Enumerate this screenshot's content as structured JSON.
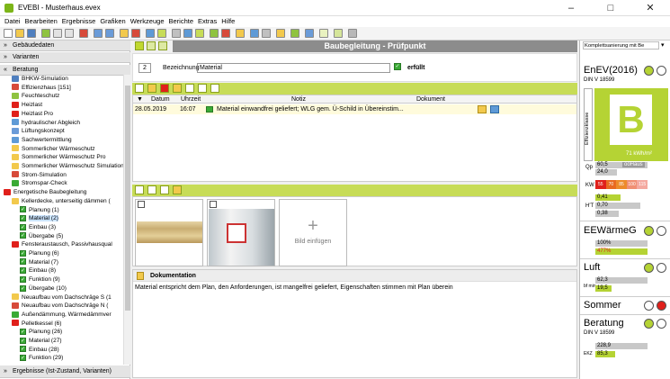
{
  "window": {
    "title": "EVEBI - Musterhaus.evex"
  },
  "menu": [
    "Datei",
    "Bearbeiten",
    "Ergebnisse",
    "Grafiken",
    "Werkzeuge",
    "Berichte",
    "Extras",
    "Hilfe"
  ],
  "left": {
    "sections": [
      "Gebäudedaten",
      "Varianten",
      "Beratung"
    ],
    "bottom": "Ergebnisse (Ist-Zustand, Varianten)",
    "tree": [
      "BHKW-Simulation",
      "Effizienzhaus [151]",
      "Feuchteschutz",
      "Heizlast",
      "Heizlast Pro",
      "hydraulischer Abgleich",
      "Lüftungskonzept",
      "Sachwertermittlung",
      "Sommerlicher Wärmeschutz",
      "Sommerlicher Wärmeschutz Pro",
      "Sommerlicher Wärmeschutz Simulation",
      "Strom-Simulation",
      "Stromspar-Check",
      "Energetische Baubegleitung",
      "Kellerdecke, unterseitig dämmen (",
      "Planung (1)",
      "Material (2)",
      "Einbau (3)",
      "Übergabe (5)",
      "Fensteraustausch, Passivhausqual",
      "Planung (6)",
      "Material (7)",
      "Einbau (8)",
      "Funktion (9)",
      "Übergabe (10)",
      "Neuaufbau vom Dachschräge S (1",
      "Neuaufbau vom Dachschräge N (",
      "Außendämmung, Wärmedämmver",
      "Pelletkessel (6)",
      "Planung (26)",
      "Material (27)",
      "Einbau (28)",
      "Funktion (29)"
    ]
  },
  "center": {
    "title": "Baubegleitung - Prüfpunkt",
    "number": "2",
    "bezeichnung_label": "Bezeichnung",
    "bezeichnung_value": "Material",
    "erfuellt_label": "erfüllt",
    "table_headers": [
      "Datum",
      "Uhrzeit",
      "Notiz",
      "Dokument"
    ],
    "row": {
      "datum": "28.05.2019",
      "uhrzeit": "16:07",
      "notiz": "Material einwandfrei geliefert; WLG gem. Ü-Schild in Übereinstim..."
    },
    "bild_einfuegen": "Bild einfügen",
    "dokumentation_title": "Dokumentation",
    "dokumentation_text": "Material entspricht dem Plan, den Anforderungen, ist mangelfrei geliefert, Eigenschaften stimmen mit Plan überein"
  },
  "right": {
    "dropdown": "Komplettsanierung mit Be",
    "enev": {
      "title": "EnEV(2016)",
      "din": "DIN V 18599",
      "klasse_label": "Effizienzklasse",
      "klasse": "B",
      "kwh": "71 kWh/m²",
      "qp_label": "Qp",
      "qp_vals": [
        "60,5",
        "24,0"
      ],
      "qp_badge": "ooHaus",
      "kw_label": "KW",
      "kw_vals": [
        "55",
        "70",
        "85",
        "100",
        "115"
      ],
      "ht_label": "H'T",
      "ht_vals": [
        "0,41",
        "0,70",
        "0,38"
      ]
    },
    "ee": {
      "title": "EEWärmeG",
      "vals": [
        "100%",
        "477%"
      ]
    },
    "luft": {
      "title": "Luft",
      "label": "bf min",
      "vals": [
        "62,3",
        "19,5"
      ]
    },
    "sommer": {
      "title": "Sommer"
    },
    "beratung": {
      "title": "Beratung",
      "din": "DIN V 18599",
      "label": "EKZ",
      "vals": [
        "228,9",
        "85,3"
      ]
    }
  },
  "colors": {
    "accent": "#c7dc57",
    "green": "#3aaa35",
    "red": "#e0201b",
    "yellowgreen": "#b5d334"
  }
}
